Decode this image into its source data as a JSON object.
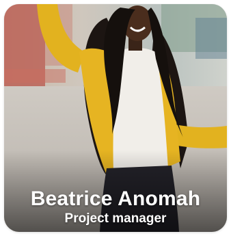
{
  "profile": {
    "name": "Beatrice Anomah",
    "role": "Project manager"
  },
  "colors": {
    "jacket": "#e6b422",
    "shirt": "#f1eee9",
    "text": "#ffffff"
  }
}
